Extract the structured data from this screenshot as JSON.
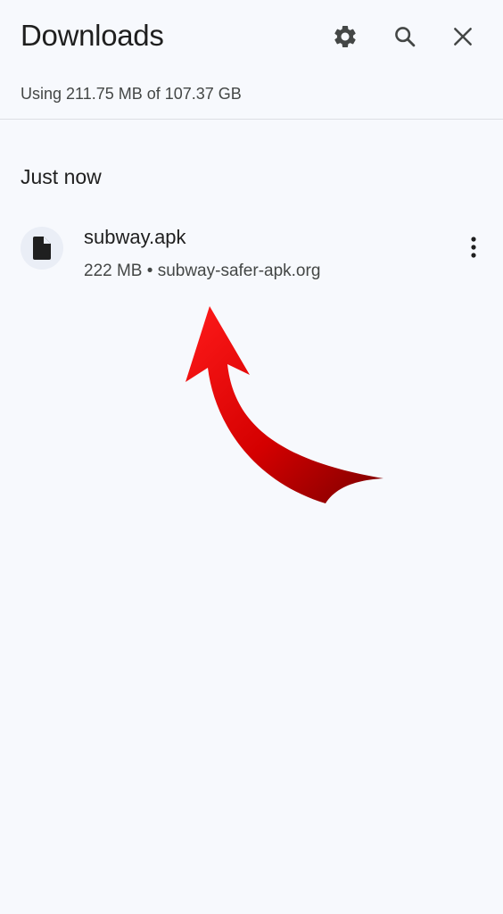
{
  "header": {
    "title": "Downloads",
    "usage": "Using 211.75 MB of 107.37 GB",
    "icons": [
      "gear-icon",
      "search-icon",
      "close-icon"
    ]
  },
  "sections": [
    {
      "heading": "Just now",
      "items": [
        {
          "name": "subway.apk",
          "size": "222 MB",
          "separator": "•",
          "source": "subway-safer-apk.org",
          "icon": "file-icon"
        }
      ]
    }
  ],
  "colors": {
    "background": "#f7f9fd",
    "text": "#1f1f1f",
    "secondary_text": "#444746",
    "arrow": "#d40000"
  }
}
